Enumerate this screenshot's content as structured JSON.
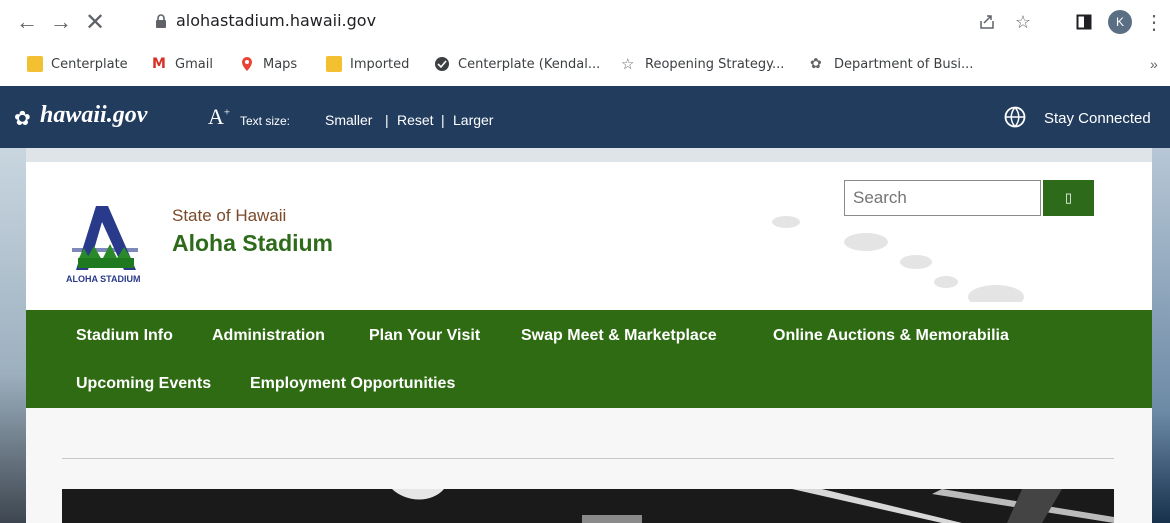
{
  "browser": {
    "url": "alohastadium.hawaii.gov",
    "avatar_initial": "K",
    "bookmarks": [
      {
        "label": "Centerplate",
        "icon": "folder-icon"
      },
      {
        "label": "Gmail",
        "icon": "gmail-icon"
      },
      {
        "label": "Maps",
        "icon": "maps-icon"
      },
      {
        "label": "Imported",
        "icon": "folder-icon"
      },
      {
        "label": "Centerplate (Kendal...",
        "icon": "globe-icon"
      },
      {
        "label": "Reopening Strategy...",
        "icon": "star-outline-icon"
      },
      {
        "label": "Department of Busi...",
        "icon": "hawaii-seal-icon"
      }
    ],
    "more_bookmarks": "»"
  },
  "govbar": {
    "logo": "hawaii.gov",
    "text_size_label": "Text size:",
    "smaller": "Smaller",
    "reset": "Reset",
    "larger": "Larger",
    "separator": "|",
    "stay_connected": "Stay Connected"
  },
  "header": {
    "state_label": "State of Hawaii",
    "site_title": "Aloha Stadium",
    "logo_text": "ALOHA STADIUM",
    "search_placeholder": "Search",
    "search_button_glyph": "▯"
  },
  "menu": {
    "items": [
      "Stadium Info",
      "Administration",
      "Plan Your Visit",
      "Swap Meet & Marketplace",
      "Online Auctions & Memorabilia",
      "Upcoming Events",
      "Employment Opportunities"
    ]
  },
  "colors": {
    "gov_bar": "#223c5e",
    "menu_green": "#2f6b12",
    "title_green": "#2d6a1a",
    "state_brown": "#7a4a2a"
  }
}
